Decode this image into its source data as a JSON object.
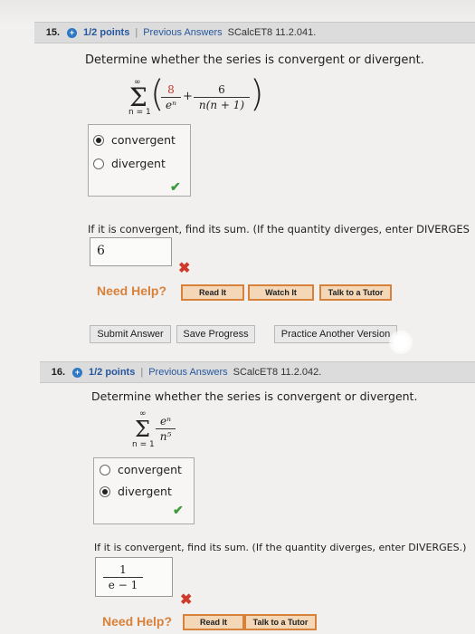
{
  "q15": {
    "number": "15.",
    "points": "1/2 points",
    "separator": "|",
    "prev_answers": "Previous Answers",
    "ref": "SCalcET8 11.2.041.",
    "prompt": "Determine whether the series is convergent or divergent.",
    "series": {
      "sigma": "Σ",
      "upper": "∞",
      "lower": "n = 1",
      "num1": "8",
      "den1": "eⁿ",
      "plus": "+",
      "num2": "6",
      "den2": "n(n + 1)"
    },
    "options": [
      "convergent",
      "divergent"
    ],
    "selected": "convergent",
    "if_convergent": "If it is convergent, find its sum. (If the quantity diverges, enter DIVERGES",
    "answer_value": "6",
    "need_help": "Need Help?",
    "help_buttons": [
      "Read It",
      "Watch It",
      "Talk to a Tutor"
    ],
    "submit_buttons": [
      "Submit Answer",
      "Save Progress",
      "Practice Another Version"
    ]
  },
  "q16": {
    "number": "16.",
    "points": "1/2 points",
    "separator": "|",
    "prev_answers": "Previous Answers",
    "ref": "SCalcET8 11.2.042.",
    "prompt": "Determine whether the series is convergent or divergent.",
    "series": {
      "sigma": "Σ",
      "upper": "∞",
      "lower": "n = 1",
      "num": "eⁿ",
      "den": "n⁵"
    },
    "options": [
      "convergent",
      "divergent"
    ],
    "selected": "divergent",
    "if_convergent": "If it is convergent, find its sum. (If the quantity diverges, enter DIVERGES.)",
    "answer_num": "1",
    "answer_den": "e − 1",
    "need_help": "Need Help?",
    "help_buttons": [
      "Read It",
      "Talk to a Tutor"
    ]
  },
  "icons": {
    "check": "✔",
    "cross": "✖",
    "plus": "+"
  },
  "colors": {
    "link": "#26579e",
    "help": "#d8813a",
    "correct": "#3c9a3c",
    "wrong": "#d03a2d"
  }
}
